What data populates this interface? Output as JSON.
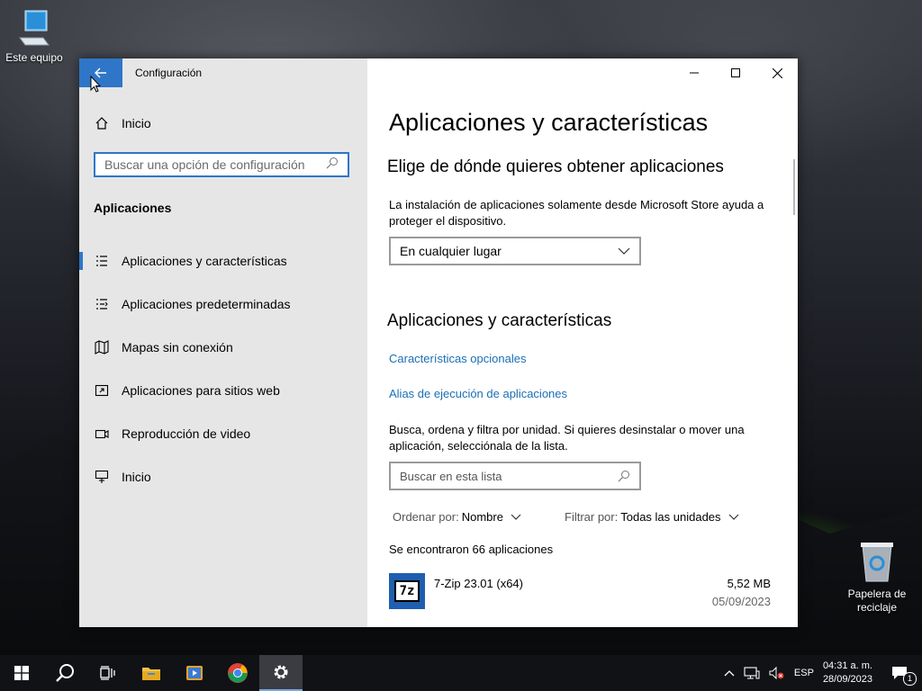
{
  "desktop": {
    "icons": [
      {
        "label": "Este equipo",
        "icon": "computer-icon"
      },
      {
        "label": "Papelera de reciclaje",
        "icon": "recycle-bin-icon"
      }
    ]
  },
  "window": {
    "title": "Configuración",
    "back_icon": "arrow-left-icon",
    "controls": [
      "minimize",
      "maximize",
      "close"
    ]
  },
  "sidebar": {
    "home_label": "Inicio",
    "search_placeholder": "Buscar una opción de configuración",
    "section_title": "Aplicaciones",
    "items": [
      {
        "label": "Aplicaciones y características",
        "icon": "apps-list-icon",
        "active": true
      },
      {
        "label": "Aplicaciones predeterminadas",
        "icon": "default-apps-icon",
        "active": false
      },
      {
        "label": "Mapas sin conexión",
        "icon": "map-icon",
        "active": false
      },
      {
        "label": "Aplicaciones para sitios web",
        "icon": "web-app-icon",
        "active": false
      },
      {
        "label": "Reproducción de video",
        "icon": "video-icon",
        "active": false
      },
      {
        "label": "Inicio",
        "icon": "startup-icon",
        "active": false
      }
    ]
  },
  "main": {
    "page_title": "Aplicaciones y características",
    "source_heading": "Elige de dónde quieres obtener aplicaciones",
    "source_desc": "La instalación de aplicaciones solamente desde Microsoft Store ayuda a proteger el dispositivo.",
    "source_dropdown": "En cualquier lugar",
    "apps_heading": "Aplicaciones y características",
    "link_optional": "Características opcionales",
    "link_alias": "Alias de ejecución de aplicaciones",
    "search_desc": "Busca, ordena y filtra por unidad. Si quieres desinstalar o mover una aplicación, selecciónala de la lista.",
    "list_search_placeholder": "Buscar en esta lista",
    "sort_label": "Ordenar por:",
    "sort_value": "Nombre",
    "filter_label": "Filtrar por:",
    "filter_value": "Todas las unidades",
    "found_text": "Se encontraron 66 aplicaciones",
    "apps": [
      {
        "name": "7-Zip 23.01 (x64)",
        "size": "5,52 MB",
        "date": "05/09/2023",
        "icon_text": "7z"
      }
    ]
  },
  "taskbar": {
    "pinned": [
      "windows-start-icon",
      "search-icon",
      "task-view-icon",
      "file-explorer-icon",
      "media-player-icon",
      "chrome-icon",
      "settings-icon"
    ],
    "active": "settings-icon",
    "tray": {
      "language": "ESP",
      "time": "04:31 a. m.",
      "date": "28/09/2023",
      "notification_count": "1"
    }
  },
  "colors": {
    "accent": "#2f76c8",
    "link": "#1a6fb5",
    "sidebar_bg": "#e6e6e6"
  }
}
